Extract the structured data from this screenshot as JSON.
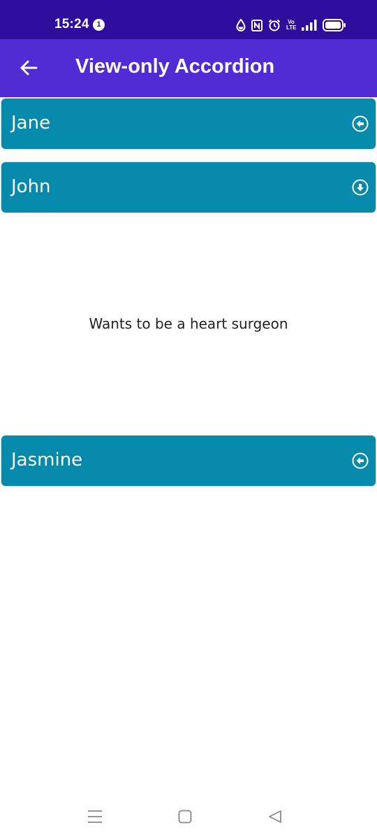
{
  "status_bar": {
    "time": "15:24",
    "notification_count": "1",
    "volte_top": "Vo",
    "volte_bottom": "LTE",
    "icons": [
      "water-drop-icon",
      "nfc-icon",
      "alarm-icon",
      "volte-icon",
      "signal-icon",
      "battery-icon"
    ]
  },
  "app_bar": {
    "back_icon": "arrow-left-icon",
    "title": "View-only Accordion"
  },
  "accordion": {
    "items": [
      {
        "title": "Jane",
        "expanded": false,
        "icon": "arrow-left-circle-icon"
      },
      {
        "title": "John",
        "expanded": true,
        "icon": "arrow-down-circle-icon",
        "content": "Wants to be a heart surgeon"
      },
      {
        "title": "Jasmine",
        "expanded": false,
        "icon": "arrow-left-circle-icon"
      }
    ]
  },
  "nav_bar": {
    "buttons": [
      "menu-icon",
      "home-icon",
      "back-icon"
    ]
  },
  "colors": {
    "status_bar": "#2e0d9c",
    "app_bar": "#512bd4",
    "accordion_header": "#068aab",
    "text_dark": "#222222"
  }
}
